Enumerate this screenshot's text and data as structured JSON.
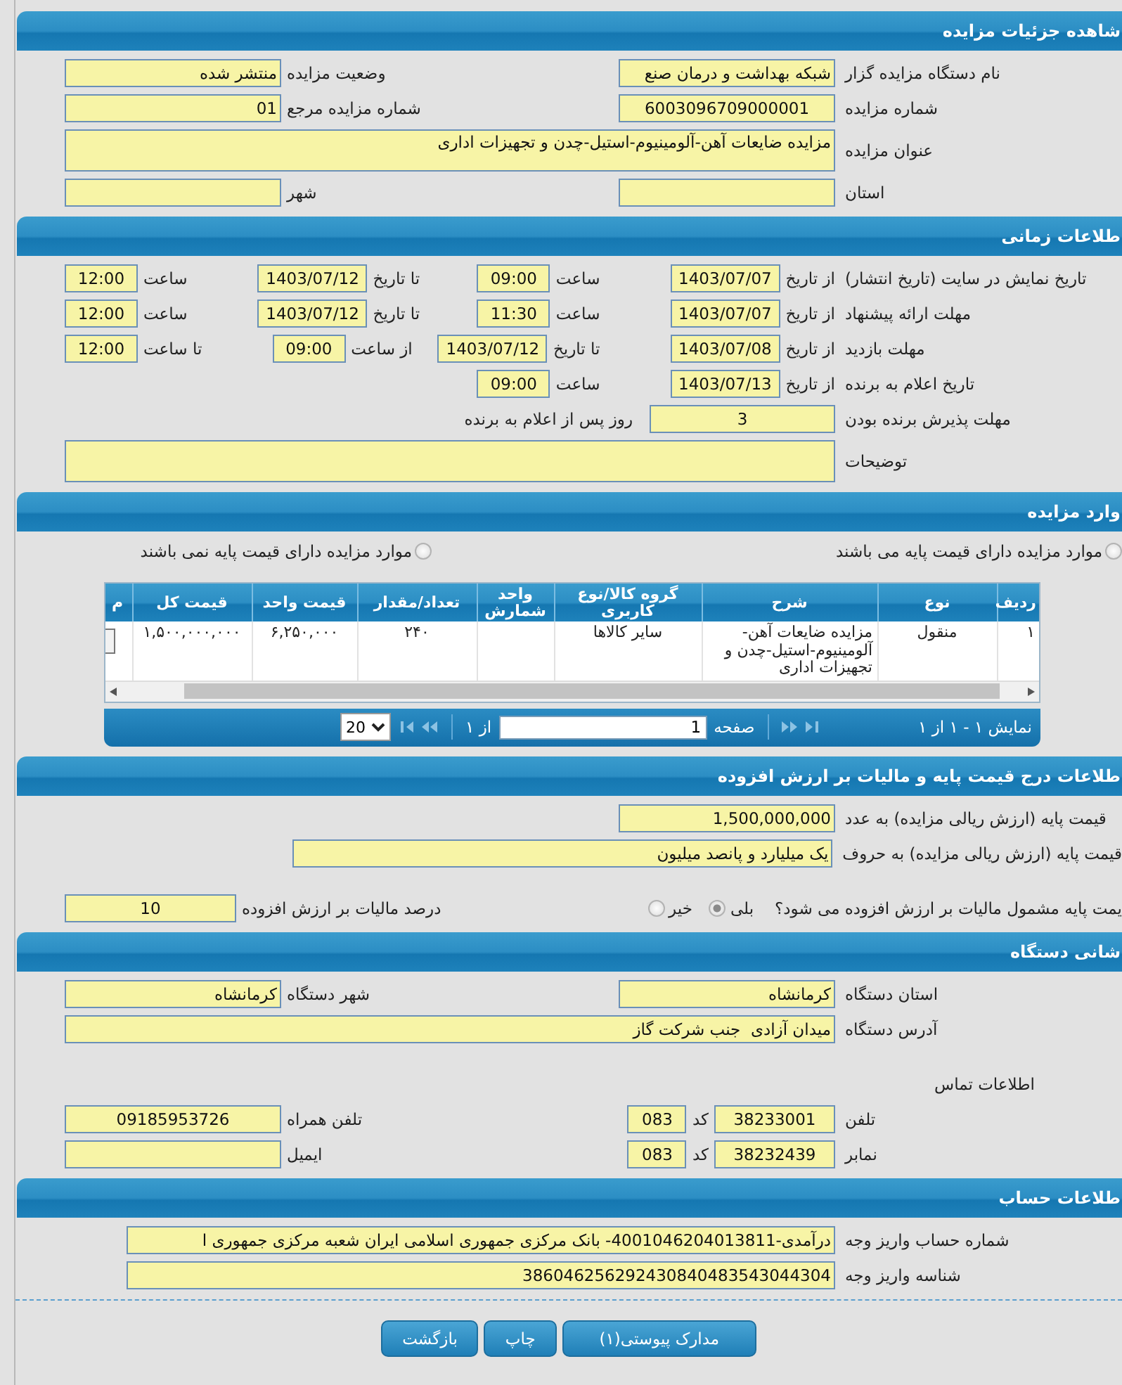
{
  "sections": [
    {
      "kind": "form",
      "title": "شاهده جزئیات مزایده",
      "rows": [
        {
          "right": [
            {
              "kind": "label",
              "text": "نام دستگاه مزایده گزار"
            },
            {
              "kind": "text",
              "value": "شبکه بهداشت و درمان صنع"
            }
          ],
          "left": [
            {
              "kind": "label",
              "text": "وضعیت مزایده"
            },
            {
              "kind": "text",
              "value": "منتشر شده"
            }
          ]
        },
        {
          "right": [
            {
              "kind": "label",
              "text": "شماره مزایده"
            },
            {
              "kind": "id",
              "value": "6003096709000001"
            }
          ],
          "left": [
            {
              "kind": "label",
              "text": "شماره مزایده مرجع"
            },
            {
              "kind": "text",
              "value": "01"
            }
          ]
        },
        {
          "right": [
            {
              "kind": "label",
              "text": "عنوان مزایده"
            },
            {
              "kind": "area",
              "value": "مزایده ضایعات آهن-آلومینیوم-استیل-چدن و تجهیزات اداری"
            }
          ]
        },
        {
          "right": [
            {
              "kind": "label",
              "text": "استان"
            },
            {
              "kind": "text"
            }
          ],
          "left": [
            {
              "kind": "label",
              "text": "شهر"
            },
            {
              "kind": "text"
            }
          ]
        }
      ]
    },
    {
      "kind": "schedule",
      "title": "طلاعات زمانی",
      "rows": [
        {
          "right": [
            {
              "kind": "label",
              "text": "تاریخ نمایش در سایت (تاریخ انتشار)"
            },
            {
              "kind": "label",
              "text": "از تاریخ"
            },
            {
              "kind": "date",
              "value": "1403/07/07"
            },
            {
              "kind": "label",
              "text": "ساعت"
            },
            {
              "kind": "time",
              "value": "09:00"
            }
          ],
          "left": [
            {
              "kind": "label",
              "text": "تا تاریخ"
            },
            {
              "kind": "date",
              "value": "1403/07/12"
            },
            {
              "kind": "label",
              "text": "ساعت"
            },
            {
              "kind": "time",
              "value": "12:00"
            }
          ]
        },
        {
          "right": [
            {
              "kind": "label",
              "text": "مهلت ارائه پیشنهاد"
            },
            {
              "kind": "label",
              "text": "از تاریخ"
            },
            {
              "kind": "date",
              "value": "1403/07/07"
            },
            {
              "kind": "label",
              "text": "ساعت"
            },
            {
              "kind": "time",
              "value": "11:30"
            }
          ],
          "left": [
            {
              "kind": "label",
              "text": "تا تاریخ"
            },
            {
              "kind": "date",
              "value": "1403/07/12"
            },
            {
              "kind": "label",
              "text": "ساعت"
            },
            {
              "kind": "time",
              "value": "12:00"
            }
          ]
        },
        {
          "right": [
            {
              "kind": "label",
              "text": "مهلت بازدید"
            },
            {
              "kind": "label",
              "text": "از تاریخ"
            },
            {
              "kind": "date",
              "value": "1403/07/08"
            },
            {
              "kind": "label",
              "text": "تا تاریخ"
            },
            {
              "kind": "date",
              "value": "1403/07/12"
            }
          ],
          "left": [
            {
              "kind": "label",
              "text": "از ساعت"
            },
            {
              "kind": "time",
              "value": "09:00"
            },
            {
              "kind": "label",
              "text": "تا ساعت"
            },
            {
              "kind": "time",
              "value": "12:00"
            }
          ]
        },
        {
          "right": [
            {
              "kind": "label",
              "text": "تاریخ اعلام به برنده"
            },
            {
              "kind": "label",
              "text": "از تاریخ"
            },
            {
              "kind": "date",
              "value": "1403/07/13"
            },
            {
              "kind": "label",
              "text": "ساعت"
            },
            {
              "kind": "time",
              "value": "09:00"
            }
          ]
        },
        {
          "right": [
            {
              "kind": "label",
              "text": "مهلت پذیرش برنده بودن"
            },
            {
              "kind": "count",
              "value": "3"
            },
            {
              "kind": "label",
              "text": "روز پس از اعلام به برنده"
            }
          ]
        },
        {
          "right": [
            {
              "kind": "label",
              "text": "توضیحات"
            },
            {
              "kind": "area"
            }
          ]
        }
      ]
    },
    {
      "kind": "items",
      "title": "وارد مزایده",
      "options": [
        {
          "text": "موارد مزایده دارای قیمت پایه می باشند",
          "selected": false
        },
        {
          "text": "موارد مزایده دارای قیمت پایه نمی باشند",
          "selected": false
        }
      ],
      "table": {
        "columns": [
          "ردیف",
          "نوع",
          "شرح",
          "گروه کالا/نوع کاربری",
          "واحد شمارش",
          "تعداد/مقدار",
          "قیمت واحد",
          "قیمت کل",
          "م"
        ],
        "rows": [
          [
            "۱",
            "منقول",
            "مزایده ضایعات آهن-آلومینیوم-استیل-چدن و تجهیزات اداری",
            "سایر کالاها",
            null,
            "۲۴۰",
            "۶,۲۵۰,۰۰۰",
            "۱,۵۰۰,۰۰۰,۰۰۰"
          ]
        ]
      },
      "pager": {
        "summary": "نمایش ۱ - ۱ از ۱",
        "page_label": "صفحه",
        "page": "1",
        "of": "از ۱",
        "page_size": "20"
      }
    },
    {
      "kind": "form",
      "title": "طلاعات درج قیمت پایه و مالیات بر ارزش افزوده",
      "rows": [
        {
          "right": [
            {
              "kind": "label",
              "text": "قیمت پایه (ارزش ریالی مزایده) به عدد"
            },
            {
              "kind": "text",
              "value": "1,500,000,000"
            }
          ]
        },
        {
          "right": [
            {
              "kind": "label",
              "text": "قیمت پایه (ارزش ریالی مزایده) به حروف"
            },
            {
              "kind": "wide",
              "value": "یک میلیارد و پانصد میلیون"
            }
          ]
        },
        {
          "right": [
            {
              "kind": "label",
              "text": "یمت پایه مشمول مالیات بر ارزش افزوده می شود؟"
            },
            {
              "kind": "radio",
              "text": "بلی",
              "selected": true
            },
            {
              "kind": "radio",
              "text": "خیر",
              "selected": false
            }
          ],
          "left": [
            {
              "kind": "label",
              "text": "درصد مالیات بر ارزش افزوده"
            },
            {
              "kind": "short",
              "value": "10"
            }
          ]
        }
      ]
    },
    {
      "kind": "form",
      "title": "شانی دستگاه",
      "rows": [
        {
          "right": [
            {
              "kind": "label",
              "text": "استان دستگاه"
            },
            {
              "kind": "text",
              "value": "کرمانشاه"
            }
          ],
          "left": [
            {
              "kind": "label",
              "text": "شهر دستگاه"
            },
            {
              "kind": "text",
              "value": "کرمانشاه"
            }
          ]
        },
        {
          "right": [
            {
              "kind": "label",
              "text": "آدرس دستگاه"
            },
            {
              "kind": "long",
              "value": "میدان آزادی  جنب شرکت گاز"
            }
          ]
        },
        {
          "right": [
            {
              "kind": "caption",
              "text": "اطلاعات تماس"
            }
          ]
        },
        {
          "right": [
            {
              "kind": "label",
              "text": "تلفن"
            },
            {
              "kind": "phone",
              "value": "38233001"
            },
            {
              "kind": "label",
              "text": "کد"
            },
            {
              "kind": "code",
              "value": "083"
            }
          ],
          "left": [
            {
              "kind": "label",
              "text": "تلفن همراه"
            },
            {
              "kind": "id",
              "value": "09185953726"
            }
          ]
        },
        {
          "right": [
            {
              "kind": "label",
              "text": "نمابر"
            },
            {
              "kind": "phone",
              "value": "38232439"
            },
            {
              "kind": "label",
              "text": "کد"
            },
            {
              "kind": "code",
              "value": "083"
            }
          ],
          "left": [
            {
              "kind": "label",
              "text": "ایمیل"
            },
            {
              "kind": "text"
            }
          ]
        }
      ]
    },
    {
      "kind": "form",
      "title": "طلاعات حساب",
      "rows": [
        {
          "right": [
            {
              "kind": "label",
              "text": "شماره حساب واریز وجه"
            },
            {
              "kind": "account",
              "value": "درآمدی-4001046204013811- بانک مرکزی جمهوری اسلامی ایران شعبه مرکزی جمهوری ا"
            }
          ]
        },
        {
          "right": [
            {
              "kind": "label",
              "text": "شناسه واریز وجه"
            },
            {
              "kind": "account",
              "value": "386046256292430840483543044304"
            }
          ]
        }
      ]
    }
  ],
  "buttons": [
    "مدارک پیوستی(۱)",
    "چاپ",
    "بازگشت"
  ]
}
